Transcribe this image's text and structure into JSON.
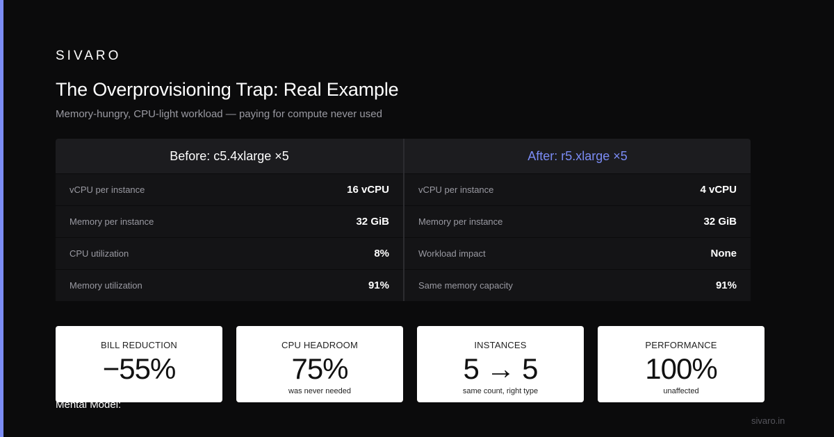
{
  "brand": "SIVARO",
  "title": "The Overprovisioning Trap: Real Example",
  "subtitle": "Memory-hungry, CPU-light workload — paying for compute never used",
  "before": {
    "header": "Before: c5.4xlarge ×5",
    "rows": [
      {
        "label": "vCPU per instance",
        "value": "16 vCPU"
      },
      {
        "label": "Memory per instance",
        "value": "32 GiB"
      },
      {
        "label": "CPU utilization",
        "value": "8%"
      },
      {
        "label": "Memory utilization",
        "value": "91%"
      }
    ]
  },
  "after": {
    "header": "After: r5.xlarge ×5",
    "rows": [
      {
        "label": "vCPU per instance",
        "value": "4 vCPU"
      },
      {
        "label": "Memory per instance",
        "value": "32 GiB"
      },
      {
        "label": "Workload impact",
        "value": "None"
      },
      {
        "label": "Same memory capacity",
        "value": "91%"
      }
    ]
  },
  "cards": [
    {
      "label": "BILL REDUCTION",
      "value": "−55%",
      "note": ""
    },
    {
      "label": "CPU HEADROOM",
      "value": "75%",
      "note": "was never needed"
    },
    {
      "label": "INSTANCES",
      "value": "5 → 5",
      "note": "same count, right type"
    },
    {
      "label": "PERFORMANCE",
      "value": "100%",
      "note": "unaffected"
    }
  ],
  "mental_model_label": "Mental Model:",
  "site": "sivaro.in",
  "colors": {
    "accent": "#7b8cf5",
    "background": "#0b0b0c",
    "card": "#ffffff"
  }
}
